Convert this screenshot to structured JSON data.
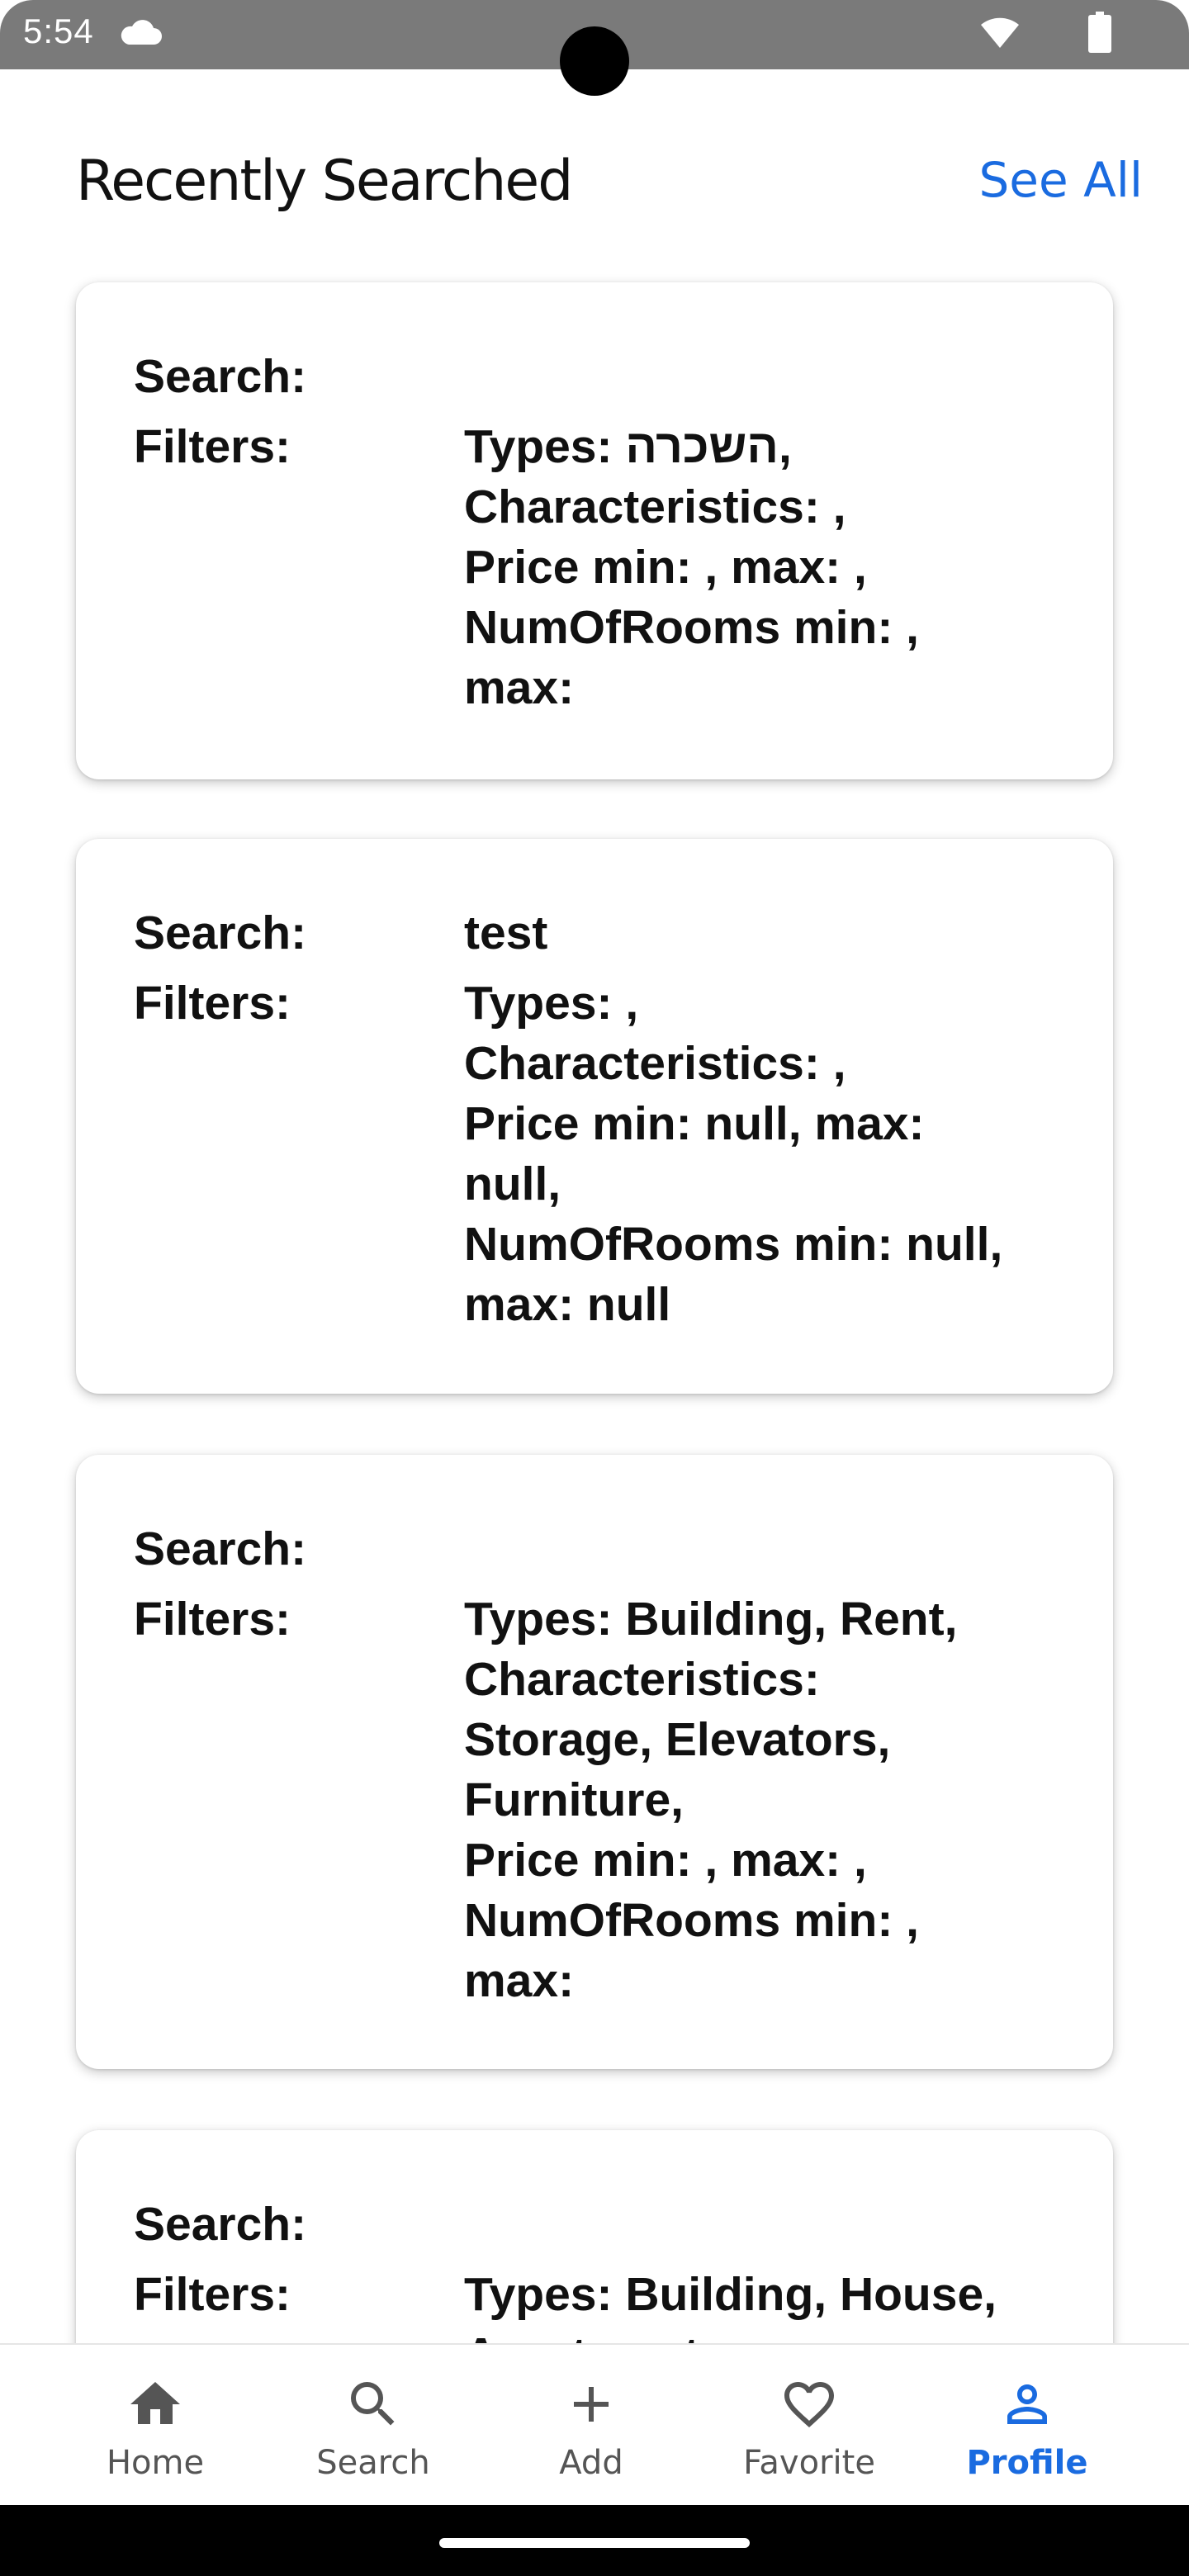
{
  "status_bar": {
    "time": "5:54",
    "icons": [
      "cloud-icon",
      "wifi-icon",
      "battery-icon"
    ]
  },
  "header": {
    "title": "Recently Searched",
    "see_all": "See All"
  },
  "labels": {
    "search": "Search:",
    "filters": "Filters:"
  },
  "cards": [
    {
      "search": "",
      "filters": "Types: השכרה,\nCharacteristics: ,\nPrice min: , max: ,\nNumOfRooms min: ,\nmax:"
    },
    {
      "search": "test",
      "filters": "Types: ,\nCharacteristics: ,\nPrice min: null, max:\nnull,\nNumOfRooms min: null,\nmax: null"
    },
    {
      "search": "",
      "filters": "Types: Building, Rent,\nCharacteristics:\nStorage, Elevators,\nFurniture,\nPrice min: , max: ,\nNumOfRooms min: ,\nmax:"
    },
    {
      "search": "",
      "filters": "Types: Building, House,\nApartment,"
    }
  ],
  "bottom_nav": [
    {
      "label": "Home",
      "icon": "home-icon",
      "active": false
    },
    {
      "label": "Search",
      "icon": "search-icon",
      "active": false
    },
    {
      "label": "Add",
      "icon": "plus-icon",
      "active": false
    },
    {
      "label": "Favorite",
      "icon": "heart-icon",
      "active": false
    },
    {
      "label": "Profile",
      "icon": "person-icon",
      "active": true
    }
  ],
  "colors": {
    "accent": "#1a6be0",
    "status_bar": "#7a7a7a",
    "nav_inactive": "#555555"
  }
}
